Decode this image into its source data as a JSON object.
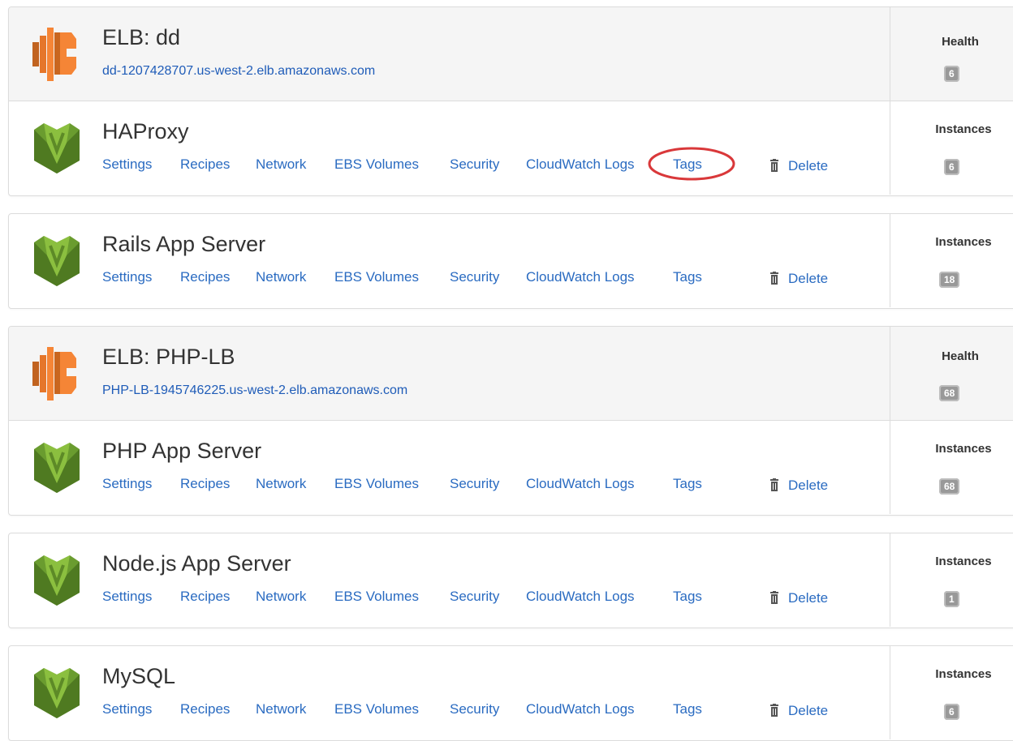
{
  "links": {
    "settings": "Settings",
    "recipes": "Recipes",
    "network": "Network",
    "ebs": "EBS Volumes",
    "security": "Security",
    "cloudwatch": "CloudWatch Logs",
    "tags": "Tags",
    "delete": "Delete"
  },
  "elb_dd": {
    "title": "ELB: dd",
    "dns": "dd-1207428707.us-west-2.elb.amazonaws.com",
    "side_label": "Health",
    "badge": "6"
  },
  "haproxy": {
    "title": "HAProxy",
    "side_label": "Instances",
    "badge": "6"
  },
  "rails": {
    "title": "Rails App Server",
    "side_label": "Instances",
    "badge": "18"
  },
  "elb_php": {
    "title": "ELB: PHP-LB",
    "dns": "PHP-LB-1945746225.us-west-2.elb.amazonaws.com",
    "side_label": "Health",
    "badge": "68"
  },
  "php": {
    "title": "PHP App Server",
    "side_label": "Instances",
    "badge": "68"
  },
  "node": {
    "title": "Node.js App Server",
    "side_label": "Instances",
    "badge": "1"
  },
  "mysql": {
    "title": "MySQL",
    "side_label": "Instances",
    "badge": "6"
  },
  "colors": {
    "link": "#2a6bc1",
    "elb_orange": "#f58536",
    "opsworks_green": "#6a9c2f",
    "annotation_red": "#d9383a",
    "badge_gray": "#999999"
  },
  "icons": {
    "elb": "elb-icon",
    "layer": "opsworks-layer-icon",
    "delete": "trash-icon"
  }
}
